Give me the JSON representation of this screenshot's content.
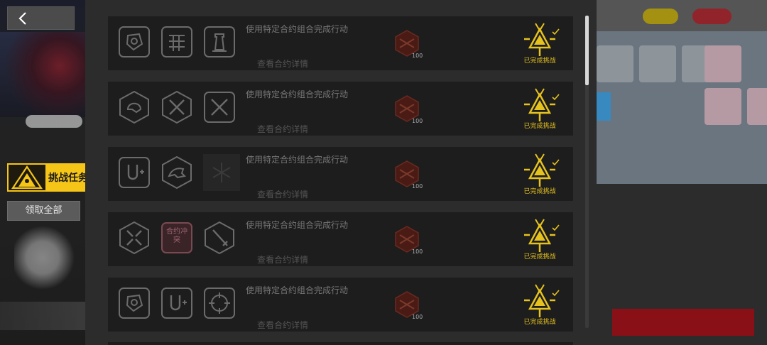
{
  "nav": {
    "back_icon": "chevron-left-icon"
  },
  "sidebar": {
    "active_tab_label": "挑战任务",
    "claim_all_label": "领取全部"
  },
  "colors": {
    "accent": "#f5c518",
    "status": "#e6c21f",
    "panel": "#2c2c2c",
    "card": "#1d1d1d"
  },
  "challenges": [
    {
      "title": "使用特定合约组合完成行动",
      "detail": "查看合约详情",
      "reward_qty": "100",
      "status": "已完成挑战",
      "icons": [
        "shield-contract-icon",
        "grid-contract-icon",
        "tower-contract-icon"
      ]
    },
    {
      "title": "使用特定合约组合完成行动",
      "detail": "查看合约详情",
      "reward_qty": "100",
      "status": "已完成挑战",
      "icons": [
        "helmet-contract-icon",
        "crossed-swords-contract-icon",
        "crossed-swords-contract-icon"
      ]
    },
    {
      "title": "使用特定合约组合完成行动",
      "detail": "查看合约详情",
      "reward_qty": "100",
      "status": "已完成挑战",
      "icons": [
        "magnet-contract-icon",
        "dragon-contract-icon",
        "snowflake-contract-icon"
      ]
    },
    {
      "title": "使用特定合约组合完成行动",
      "detail": "查看合约详情",
      "reward_qty": "100",
      "status": "已完成挑战",
      "icons": [
        "broken-swords-contract-icon",
        "contract-conflict-icon",
        "sword-contract-icon"
      ],
      "conflict_label": "合约冲突"
    },
    {
      "title": "使用特定合约组合完成行动",
      "detail": "查看合约详情",
      "reward_qty": "100",
      "status": "已完成挑战",
      "icons": [
        "shield-contract-icon",
        "magnet-contract-icon",
        "crosshair-contract-icon"
      ]
    }
  ]
}
